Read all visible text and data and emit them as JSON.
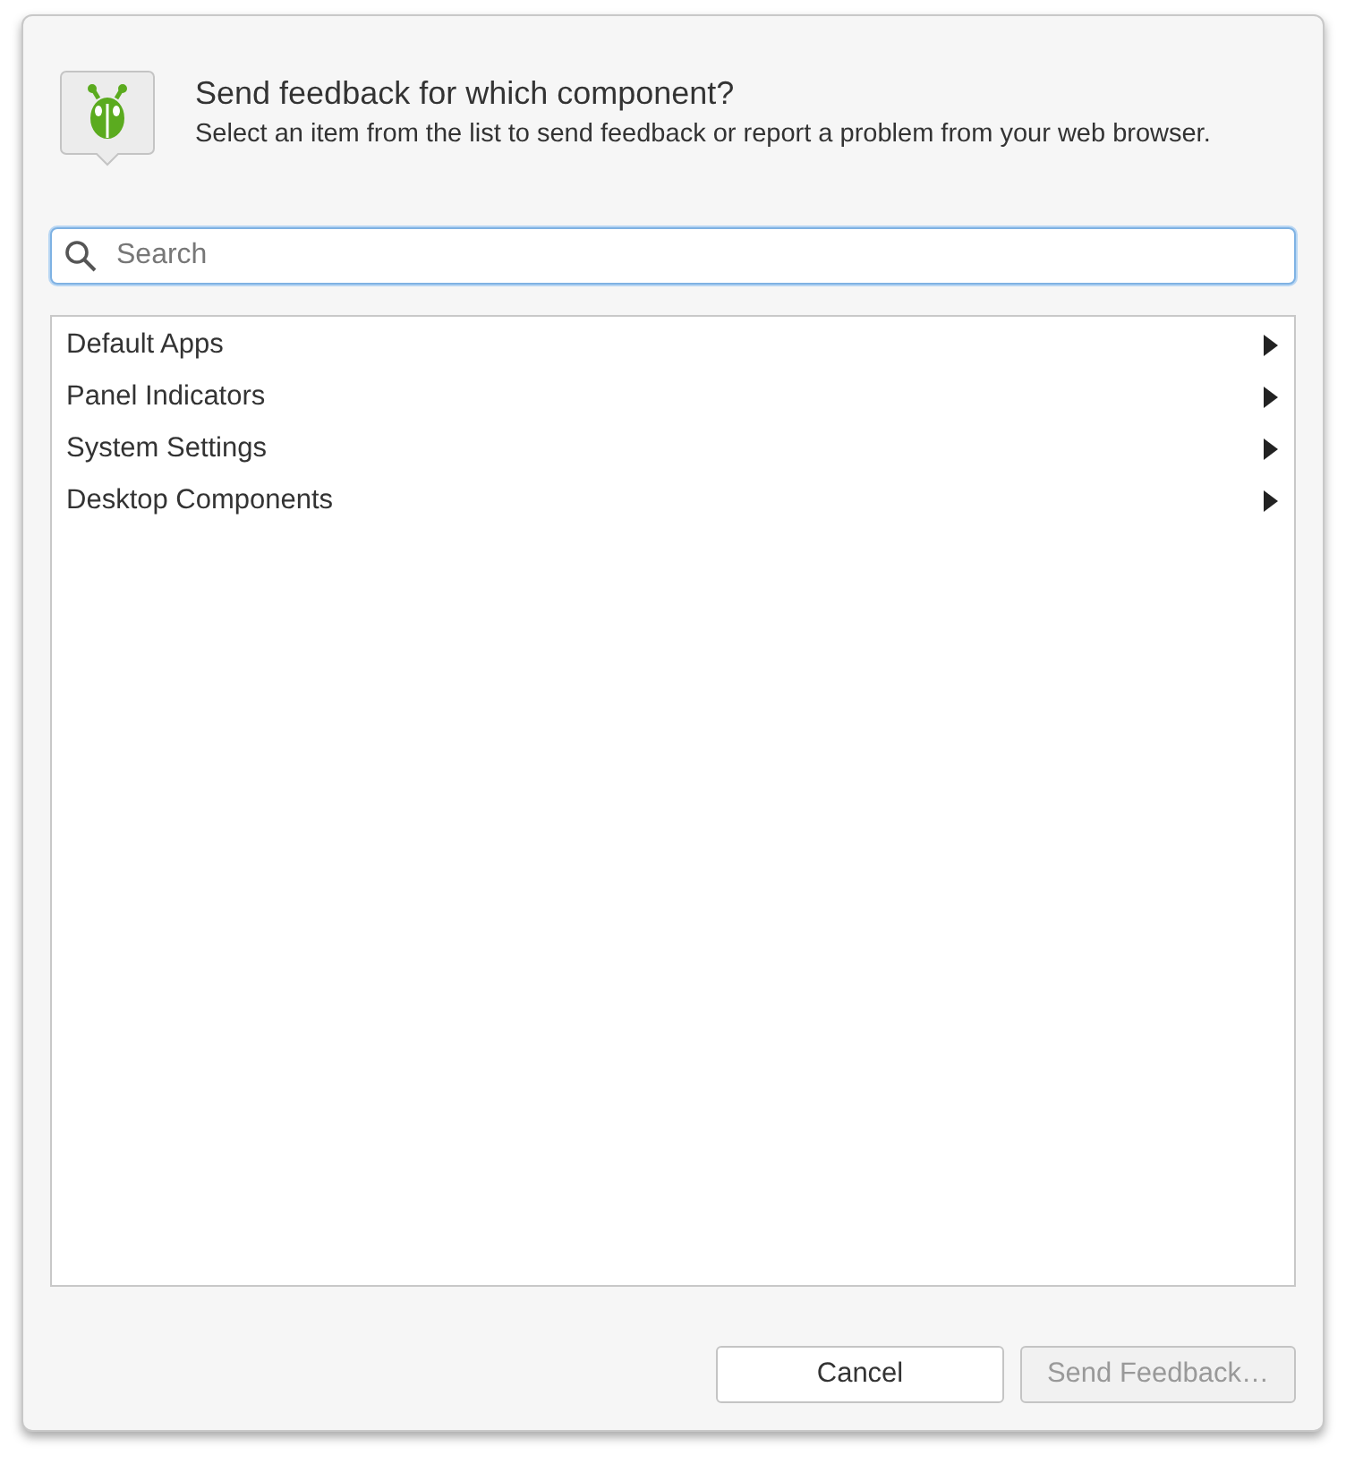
{
  "header": {
    "title": "Send feedback for which component?",
    "description": "Select an item from the list to send feedback or report a problem from your web browser."
  },
  "search": {
    "placeholder": "Search"
  },
  "list": {
    "items": [
      {
        "label": "Default Apps"
      },
      {
        "label": "Panel Indicators"
      },
      {
        "label": "System Settings"
      },
      {
        "label": "Desktop Components"
      }
    ]
  },
  "buttons": [
    {
      "label": "Cancel",
      "disabled": false
    },
    {
      "label": "Send Feedback…",
      "disabled": true
    }
  ]
}
